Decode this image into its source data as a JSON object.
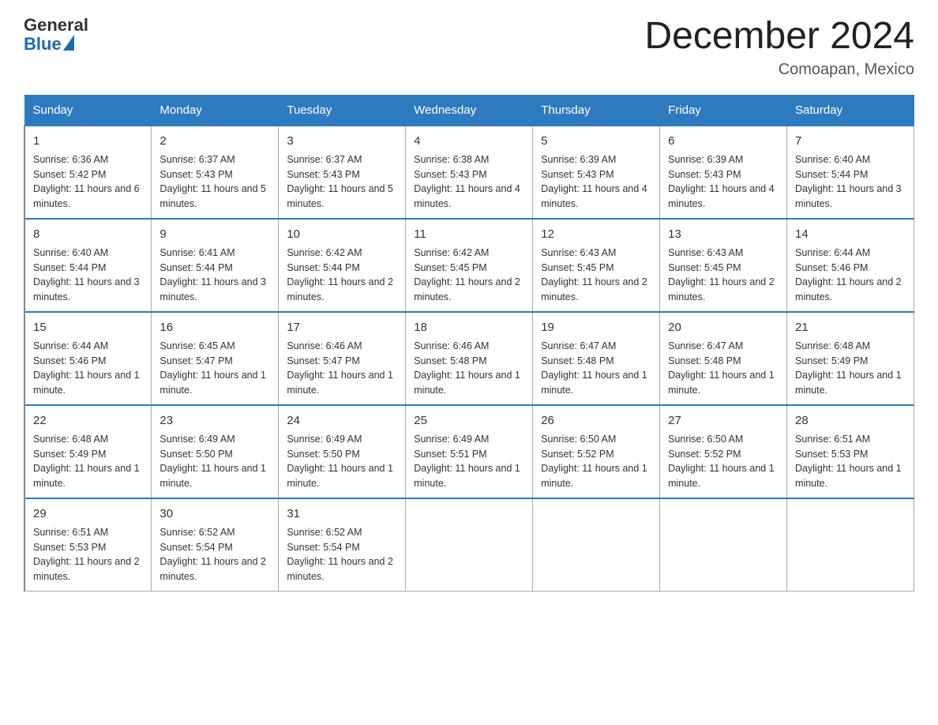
{
  "header": {
    "logo_general": "General",
    "logo_blue": "Blue",
    "month_year": "December 2024",
    "location": "Comoapan, Mexico"
  },
  "days_of_week": [
    "Sunday",
    "Monday",
    "Tuesday",
    "Wednesday",
    "Thursday",
    "Friday",
    "Saturday"
  ],
  "weeks": [
    [
      {
        "day": "1",
        "sunrise": "Sunrise: 6:36 AM",
        "sunset": "Sunset: 5:42 PM",
        "daylight": "Daylight: 11 hours and 6 minutes."
      },
      {
        "day": "2",
        "sunrise": "Sunrise: 6:37 AM",
        "sunset": "Sunset: 5:43 PM",
        "daylight": "Daylight: 11 hours and 5 minutes."
      },
      {
        "day": "3",
        "sunrise": "Sunrise: 6:37 AM",
        "sunset": "Sunset: 5:43 PM",
        "daylight": "Daylight: 11 hours and 5 minutes."
      },
      {
        "day": "4",
        "sunrise": "Sunrise: 6:38 AM",
        "sunset": "Sunset: 5:43 PM",
        "daylight": "Daylight: 11 hours and 4 minutes."
      },
      {
        "day": "5",
        "sunrise": "Sunrise: 6:39 AM",
        "sunset": "Sunset: 5:43 PM",
        "daylight": "Daylight: 11 hours and 4 minutes."
      },
      {
        "day": "6",
        "sunrise": "Sunrise: 6:39 AM",
        "sunset": "Sunset: 5:43 PM",
        "daylight": "Daylight: 11 hours and 4 minutes."
      },
      {
        "day": "7",
        "sunrise": "Sunrise: 6:40 AM",
        "sunset": "Sunset: 5:44 PM",
        "daylight": "Daylight: 11 hours and 3 minutes."
      }
    ],
    [
      {
        "day": "8",
        "sunrise": "Sunrise: 6:40 AM",
        "sunset": "Sunset: 5:44 PM",
        "daylight": "Daylight: 11 hours and 3 minutes."
      },
      {
        "day": "9",
        "sunrise": "Sunrise: 6:41 AM",
        "sunset": "Sunset: 5:44 PM",
        "daylight": "Daylight: 11 hours and 3 minutes."
      },
      {
        "day": "10",
        "sunrise": "Sunrise: 6:42 AM",
        "sunset": "Sunset: 5:44 PM",
        "daylight": "Daylight: 11 hours and 2 minutes."
      },
      {
        "day": "11",
        "sunrise": "Sunrise: 6:42 AM",
        "sunset": "Sunset: 5:45 PM",
        "daylight": "Daylight: 11 hours and 2 minutes."
      },
      {
        "day": "12",
        "sunrise": "Sunrise: 6:43 AM",
        "sunset": "Sunset: 5:45 PM",
        "daylight": "Daylight: 11 hours and 2 minutes."
      },
      {
        "day": "13",
        "sunrise": "Sunrise: 6:43 AM",
        "sunset": "Sunset: 5:45 PM",
        "daylight": "Daylight: 11 hours and 2 minutes."
      },
      {
        "day": "14",
        "sunrise": "Sunrise: 6:44 AM",
        "sunset": "Sunset: 5:46 PM",
        "daylight": "Daylight: 11 hours and 2 minutes."
      }
    ],
    [
      {
        "day": "15",
        "sunrise": "Sunrise: 6:44 AM",
        "sunset": "Sunset: 5:46 PM",
        "daylight": "Daylight: 11 hours and 1 minute."
      },
      {
        "day": "16",
        "sunrise": "Sunrise: 6:45 AM",
        "sunset": "Sunset: 5:47 PM",
        "daylight": "Daylight: 11 hours and 1 minute."
      },
      {
        "day": "17",
        "sunrise": "Sunrise: 6:46 AM",
        "sunset": "Sunset: 5:47 PM",
        "daylight": "Daylight: 11 hours and 1 minute."
      },
      {
        "day": "18",
        "sunrise": "Sunrise: 6:46 AM",
        "sunset": "Sunset: 5:48 PM",
        "daylight": "Daylight: 11 hours and 1 minute."
      },
      {
        "day": "19",
        "sunrise": "Sunrise: 6:47 AM",
        "sunset": "Sunset: 5:48 PM",
        "daylight": "Daylight: 11 hours and 1 minute."
      },
      {
        "day": "20",
        "sunrise": "Sunrise: 6:47 AM",
        "sunset": "Sunset: 5:48 PM",
        "daylight": "Daylight: 11 hours and 1 minute."
      },
      {
        "day": "21",
        "sunrise": "Sunrise: 6:48 AM",
        "sunset": "Sunset: 5:49 PM",
        "daylight": "Daylight: 11 hours and 1 minute."
      }
    ],
    [
      {
        "day": "22",
        "sunrise": "Sunrise: 6:48 AM",
        "sunset": "Sunset: 5:49 PM",
        "daylight": "Daylight: 11 hours and 1 minute."
      },
      {
        "day": "23",
        "sunrise": "Sunrise: 6:49 AM",
        "sunset": "Sunset: 5:50 PM",
        "daylight": "Daylight: 11 hours and 1 minute."
      },
      {
        "day": "24",
        "sunrise": "Sunrise: 6:49 AM",
        "sunset": "Sunset: 5:50 PM",
        "daylight": "Daylight: 11 hours and 1 minute."
      },
      {
        "day": "25",
        "sunrise": "Sunrise: 6:49 AM",
        "sunset": "Sunset: 5:51 PM",
        "daylight": "Daylight: 11 hours and 1 minute."
      },
      {
        "day": "26",
        "sunrise": "Sunrise: 6:50 AM",
        "sunset": "Sunset: 5:52 PM",
        "daylight": "Daylight: 11 hours and 1 minute."
      },
      {
        "day": "27",
        "sunrise": "Sunrise: 6:50 AM",
        "sunset": "Sunset: 5:52 PM",
        "daylight": "Daylight: 11 hours and 1 minute."
      },
      {
        "day": "28",
        "sunrise": "Sunrise: 6:51 AM",
        "sunset": "Sunset: 5:53 PM",
        "daylight": "Daylight: 11 hours and 1 minute."
      }
    ],
    [
      {
        "day": "29",
        "sunrise": "Sunrise: 6:51 AM",
        "sunset": "Sunset: 5:53 PM",
        "daylight": "Daylight: 11 hours and 2 minutes."
      },
      {
        "day": "30",
        "sunrise": "Sunrise: 6:52 AM",
        "sunset": "Sunset: 5:54 PM",
        "daylight": "Daylight: 11 hours and 2 minutes."
      },
      {
        "day": "31",
        "sunrise": "Sunrise: 6:52 AM",
        "sunset": "Sunset: 5:54 PM",
        "daylight": "Daylight: 11 hours and 2 minutes."
      },
      null,
      null,
      null,
      null
    ]
  ]
}
